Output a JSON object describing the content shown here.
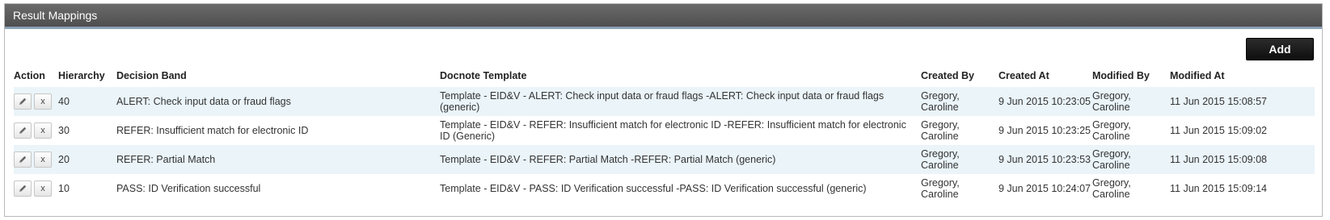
{
  "panel": {
    "title": "Result Mappings",
    "add_label": "Add"
  },
  "table": {
    "headers": {
      "action": "Action",
      "hierarchy": "Hierarchy",
      "decision_band": "Decision Band",
      "docnote_template": "Docnote Template",
      "created_by": "Created By",
      "created_at": "Created At",
      "modified_by": "Modified By",
      "modified_at": "Modified At"
    },
    "rows": [
      {
        "hierarchy": "40",
        "decision_band": "ALERT: Check input data or fraud flags",
        "docnote_template": "Template - EID&V - ALERT: Check input data or fraud flags -ALERT: Check input data or fraud flags (generic)",
        "created_by": "Gregory, Caroline",
        "created_at": "9 Jun 2015 10:23:05",
        "modified_by": "Gregory, Caroline",
        "modified_at": "11 Jun 2015 15:08:57"
      },
      {
        "hierarchy": "30",
        "decision_band": "REFER: Insufficient match for electronic ID",
        "docnote_template": "Template - EID&V - REFER: Insufficient match for electronic ID -REFER: Insufficient match for electronic ID (Generic)",
        "created_by": "Gregory, Caroline",
        "created_at": "9 Jun 2015 10:23:25",
        "modified_by": "Gregory, Caroline",
        "modified_at": "11 Jun 2015 15:09:02"
      },
      {
        "hierarchy": "20",
        "decision_band": "REFER: Partial Match",
        "docnote_template": "Template - EID&V - REFER: Partial Match -REFER: Partial Match (generic)",
        "created_by": "Gregory, Caroline",
        "created_at": "9 Jun 2015 10:23:53",
        "modified_by": "Gregory, Caroline",
        "modified_at": "11 Jun 2015 15:09:08"
      },
      {
        "hierarchy": "10",
        "decision_band": "PASS: ID Verification successful",
        "docnote_template": "Template - EID&V - PASS: ID Verification successful -PASS: ID Verification successful (generic)",
        "created_by": "Gregory, Caroline",
        "created_at": "9 Jun 2015 10:24:07",
        "modified_by": "Gregory, Caroline",
        "modified_at": "11 Jun 2015 15:09:14"
      }
    ],
    "row_actions": {
      "edit_icon": "pencil-icon",
      "delete_label": "x"
    }
  },
  "colors": {
    "header_bg": "#5a5a5a",
    "accent_line": "#8aa0b4",
    "row_alt": "#eaf4f9",
    "button_bg": "#111111"
  }
}
